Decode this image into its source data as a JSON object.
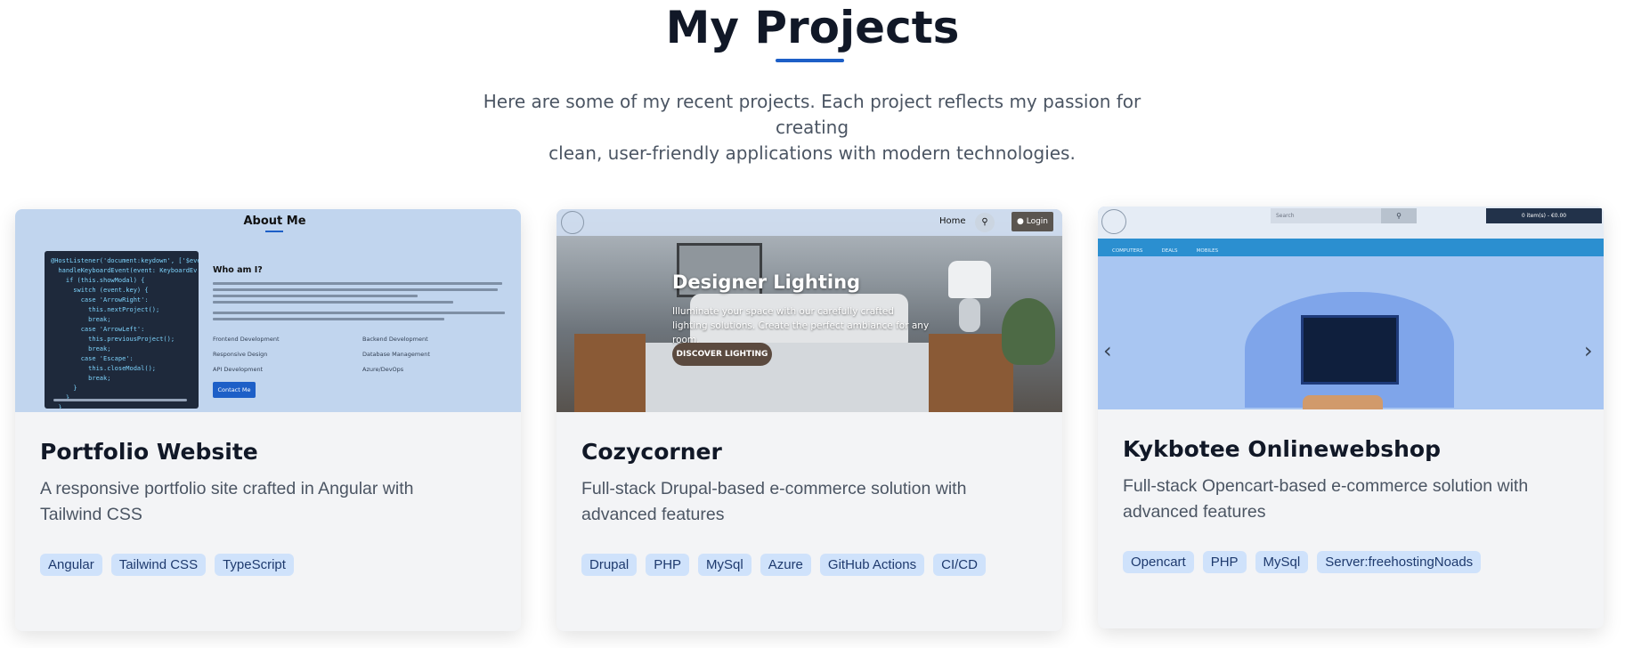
{
  "section": {
    "title": "My Projects",
    "subtitle_line1": "Here are some of my recent projects. Each project reflects my passion for creating",
    "subtitle_line2": "clean, user-friendly applications with modern technologies."
  },
  "projects": [
    {
      "title": "Portfolio Website",
      "description_line1": "A responsive portfolio site crafted in Angular with",
      "description_line2": "Tailwind CSS",
      "tags": [
        "Angular",
        "Tailwind CSS",
        "TypeScript"
      ],
      "preview": {
        "heading": "About Me",
        "who": "Who am I?",
        "code": "@HostListener('document:keydown', ['$ever\n  handleKeyboardEvent(event: KeyboardEv\n    if (this.showModal) {\n      switch (event.key) {\n        case 'ArrowRight':\n          this.nextProject();\n          break;\n        case 'ArrowLeft':\n          this.previousProject();\n          break;\n        case 'Escape':\n          this.closeModal();\n          break;\n      }\n    }\n  }",
        "skills": [
          "Frontend Development",
          "Backend Development",
          "Responsive Design",
          "Database Management",
          "API Development",
          "Azure/DevOps"
        ],
        "button": "Contact Me"
      }
    },
    {
      "title": "Cozycorner",
      "description_line1": "Full-stack Drupal-based e-commerce solution with",
      "description_line2": "advanced features",
      "tags": [
        "Drupal",
        "PHP",
        "MySql",
        "Azure",
        "GitHub Actions",
        "CI/CD"
      ],
      "preview": {
        "nav_home": "Home",
        "nav_login": "Login",
        "headline": "Designer Lighting",
        "text": "Illuminate your space with our carefully crafted lighting solutions. Create the perfect ambiance for any room.",
        "button": "DISCOVER LIGHTING"
      }
    },
    {
      "title": "Kykbotee Onlinewebshop",
      "description_line1": "Full-stack Opencart-based e-commerce solution with",
      "description_line2": "advanced features",
      "tags": [
        "Opencart",
        "PHP",
        "MySql",
        "Server:freehostingNoads"
      ],
      "preview": {
        "search_placeholder": "Search",
        "cart": "0 item(s) - €0.00",
        "menu": [
          "COMPUTERS",
          "DEALS",
          "MOBILES"
        ]
      }
    }
  ],
  "icons": {
    "prev": "chevron-left-icon",
    "next": "chevron-right-icon",
    "search": "search-icon",
    "user": "user-icon"
  },
  "colors": {
    "accent": "#1d5fc7",
    "tag_bg": "#cfe2fb",
    "card_bg": "#f3f4f6"
  }
}
